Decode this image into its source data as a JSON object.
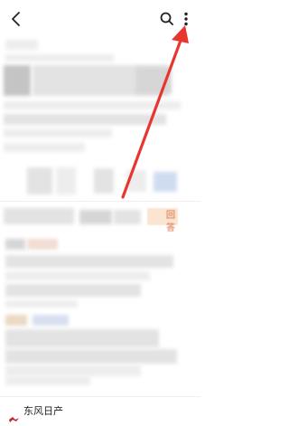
{
  "header": {
    "back_icon": "chevron-left-icon",
    "search_icon": "search-icon",
    "menu_icon": "more-vertical-icon"
  },
  "content": {
    "answer_tag_label": "回答"
  },
  "footer": {
    "brand_label": "东风日产"
  },
  "colors": {
    "arrow": "#e8352e",
    "tag_text": "#d4652b",
    "tag_bg": "#fbe4d2",
    "footer_logo": "#c0262d"
  }
}
